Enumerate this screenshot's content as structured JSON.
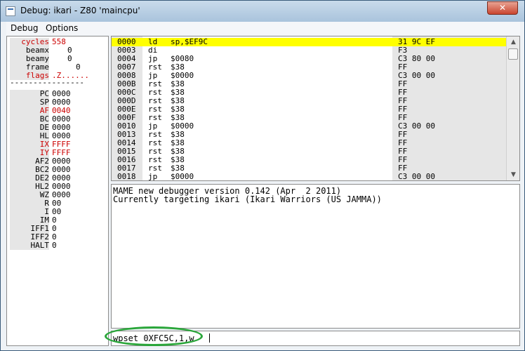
{
  "window": {
    "title": "Debug: ikari - Z80 'maincpu'",
    "close_glyph": "✕"
  },
  "menu": [
    "Debug",
    "Options"
  ],
  "registers": [
    {
      "name": "cycles",
      "value": "558",
      "red": true
    },
    {
      "name": "beamx",
      "value": "0",
      "red": false
    },
    {
      "name": "beamy",
      "value": "0",
      "red": false
    },
    {
      "name": "frame",
      "value": "0",
      "red": false
    },
    {
      "name": "flags",
      "value": ".Z......",
      "red": true
    },
    {
      "name": "PC",
      "value": "0000",
      "red": false
    },
    {
      "name": "SP",
      "value": "0000",
      "red": false
    },
    {
      "name": "AF",
      "value": "0040",
      "red": true
    },
    {
      "name": "BC",
      "value": "0000",
      "red": false
    },
    {
      "name": "DE",
      "value": "0000",
      "red": false
    },
    {
      "name": "HL",
      "value": "0000",
      "red": false
    },
    {
      "name": "IX",
      "value": "FFFF",
      "red": true
    },
    {
      "name": "IY",
      "value": "FFFF",
      "red": true
    },
    {
      "name": "AF2",
      "value": "0000",
      "red": false
    },
    {
      "name": "BC2",
      "value": "0000",
      "red": false
    },
    {
      "name": "DE2",
      "value": "0000",
      "red": false
    },
    {
      "name": "HL2",
      "value": "0000",
      "red": false
    },
    {
      "name": "WZ",
      "value": "0000",
      "red": false
    },
    {
      "name": "R",
      "value": "00",
      "red": false
    },
    {
      "name": "I",
      "value": "00",
      "red": false
    },
    {
      "name": "IM",
      "value": "0",
      "red": false
    },
    {
      "name": "IFF1",
      "value": "0",
      "red": false
    },
    {
      "name": "IFF2",
      "value": "0",
      "red": false
    },
    {
      "name": "HALT",
      "value": "0",
      "red": false
    }
  ],
  "separator": "----------------",
  "disasm": [
    {
      "addr": "0000",
      "mnem": "ld",
      "op": "sp,$EF9C",
      "bytes": "31 9C EF",
      "current": true
    },
    {
      "addr": "0003",
      "mnem": "di",
      "op": "",
      "bytes": "F3",
      "current": false
    },
    {
      "addr": "0004",
      "mnem": "jp",
      "op": "$0080",
      "bytes": "C3 80 00",
      "current": false
    },
    {
      "addr": "0007",
      "mnem": "rst",
      "op": "$38",
      "bytes": "FF",
      "current": false
    },
    {
      "addr": "0008",
      "mnem": "jp",
      "op": "$0000",
      "bytes": "C3 00 00",
      "current": false
    },
    {
      "addr": "000B",
      "mnem": "rst",
      "op": "$38",
      "bytes": "FF",
      "current": false
    },
    {
      "addr": "000C",
      "mnem": "rst",
      "op": "$38",
      "bytes": "FF",
      "current": false
    },
    {
      "addr": "000D",
      "mnem": "rst",
      "op": "$38",
      "bytes": "FF",
      "current": false
    },
    {
      "addr": "000E",
      "mnem": "rst",
      "op": "$38",
      "bytes": "FF",
      "current": false
    },
    {
      "addr": "000F",
      "mnem": "rst",
      "op": "$38",
      "bytes": "FF",
      "current": false
    },
    {
      "addr": "0010",
      "mnem": "jp",
      "op": "$0000",
      "bytes": "C3 00 00",
      "current": false
    },
    {
      "addr": "0013",
      "mnem": "rst",
      "op": "$38",
      "bytes": "FF",
      "current": false
    },
    {
      "addr": "0014",
      "mnem": "rst",
      "op": "$38",
      "bytes": "FF",
      "current": false
    },
    {
      "addr": "0015",
      "mnem": "rst",
      "op": "$38",
      "bytes": "FF",
      "current": false
    },
    {
      "addr": "0016",
      "mnem": "rst",
      "op": "$38",
      "bytes": "FF",
      "current": false
    },
    {
      "addr": "0017",
      "mnem": "rst",
      "op": "$38",
      "bytes": "FF",
      "current": false
    },
    {
      "addr": "0018",
      "mnem": "jp",
      "op": "$0000",
      "bytes": "C3 00 00",
      "current": false
    }
  ],
  "console": [
    "MAME new debugger version 0.142 (Apr  2 2011)",
    "Currently targeting ikari (Ikari Warriors (US JAMMA))"
  ],
  "command": "wpset 0XFC5C,1,w",
  "colors": {
    "highlight": "#ffff00",
    "register_changed": "#cc0000",
    "annotation_ring": "#2aa63a"
  }
}
